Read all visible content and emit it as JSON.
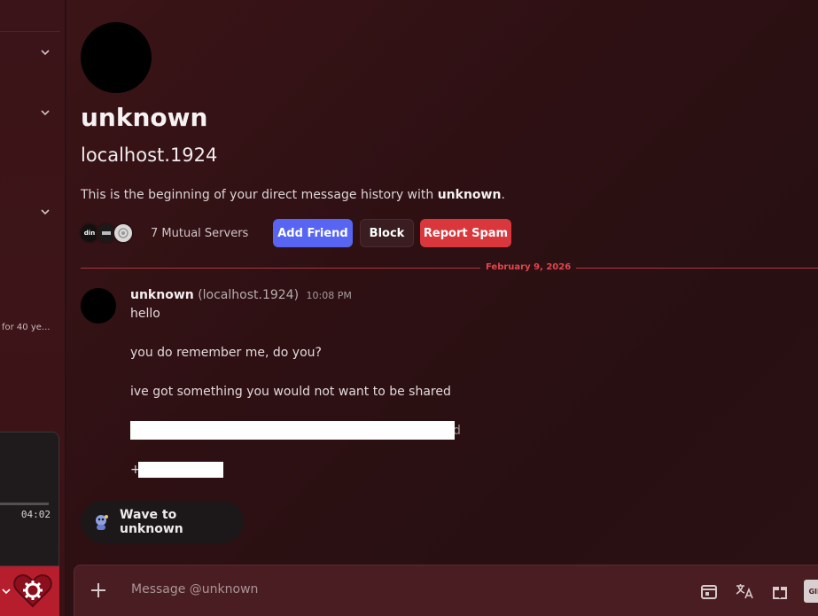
{
  "sidebar": {
    "snippet_text": "for 40 ye...",
    "player": {
      "time": "04:02",
      "progress": 1.0
    }
  },
  "profile": {
    "display_name": "unknown",
    "username": "localhost.1924",
    "intro_prefix": "This is the beginning of your direct message history with ",
    "intro_name": "unknown",
    "intro_suffix": ".",
    "mutual_servers": "7 Mutual Servers",
    "server_badges": [
      "din",
      "",
      ""
    ],
    "buttons": {
      "add_friend": "Add Friend",
      "block": "Block",
      "report_spam": "Report Spam"
    }
  },
  "divider": {
    "date": "February 9, 2026"
  },
  "message": {
    "author": "unknown",
    "handle": "(localhost.1924)",
    "timestamp": "10:08 PM",
    "lines": [
      "hello",
      "you do remember me, do you?",
      "ive got something you would not want to be shared",
      "d",
      "+"
    ]
  },
  "wave": {
    "label": "Wave to unknown"
  },
  "composer": {
    "placeholder": "Message @unknown",
    "gif_label": "GIF"
  },
  "colors": {
    "accent_add": "#5865f2",
    "accent_spam": "#da373c",
    "divider": "#e0474c"
  }
}
